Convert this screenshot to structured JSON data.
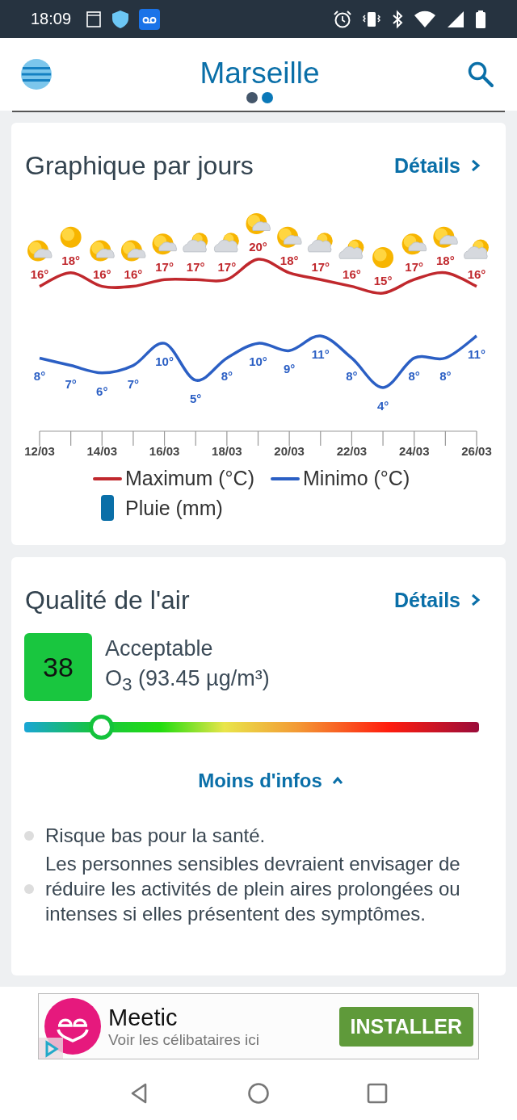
{
  "status_bar": {
    "time": "18:09"
  },
  "header": {
    "title": "Marseille",
    "pages": [
      {
        "selected": true
      },
      {
        "selected": false
      }
    ]
  },
  "forecast_card": {
    "title": "Graphique par jours",
    "details_link": "Détails",
    "days": [
      {
        "kind": "partly",
        "max": "16°",
        "min": "8°"
      },
      {
        "kind": "sun",
        "max": "18°",
        "min": "7°"
      },
      {
        "kind": "partly",
        "max": "16°",
        "min": "6°"
      },
      {
        "kind": "partly",
        "max": "16°",
        "min": "7°"
      },
      {
        "kind": "partly",
        "max": "17°",
        "min": "10°"
      },
      {
        "kind": "cloudy",
        "max": "17°",
        "min": "5°"
      },
      {
        "kind": "cloudy",
        "max": "17°",
        "min": "8°"
      },
      {
        "kind": "partly",
        "max": "20°",
        "min": "10°"
      },
      {
        "kind": "partly",
        "max": "18°",
        "min": "9°"
      },
      {
        "kind": "cloudy",
        "max": "17°",
        "min": "11°"
      },
      {
        "kind": "cloudy",
        "max": "16°",
        "min": "8°"
      },
      {
        "kind": "sun",
        "max": "15°",
        "min": "4°"
      },
      {
        "kind": "partly",
        "max": "17°",
        "min": "8°"
      },
      {
        "kind": "partly",
        "max": "18°",
        "min": "8°"
      },
      {
        "kind": "cloudy",
        "max": "16°",
        "min": "11°"
      }
    ],
    "axis_labels": [
      "12/03",
      "14/03",
      "16/03",
      "18/03",
      "20/03",
      "22/03",
      "24/03",
      "26/03"
    ],
    "legend": [
      {
        "name": "Maximum (°C)",
        "color": "#c0282d",
        "kind": "line"
      },
      {
        "name": "Minimo (°C)",
        "color": "#2b5fc4",
        "kind": "line"
      },
      {
        "name": "Pluie (mm)",
        "color": "#0a6fa8",
        "kind": "bar"
      }
    ]
  },
  "air_card": {
    "title": "Qualité de l'air",
    "details_link": "Détails",
    "index": "38",
    "category": "Acceptable",
    "pollutant": "O$_{3}$ (93.45 µg/m³)",
    "level": 0.17,
    "toggle": {
      "label": "Moins d'infos",
      "expanded": true
    },
    "notes": [
      "Risque bas pour la santé.",
      "Les personnes sensibles devraient envisager de réduire les activités de plein aires prolongées ou intenses si elles présentent des symptômes."
    ]
  },
  "ad": {
    "title": "Meetic",
    "subtitle": "Voir les célibataires ici",
    "button": "INSTALLER"
  }
}
